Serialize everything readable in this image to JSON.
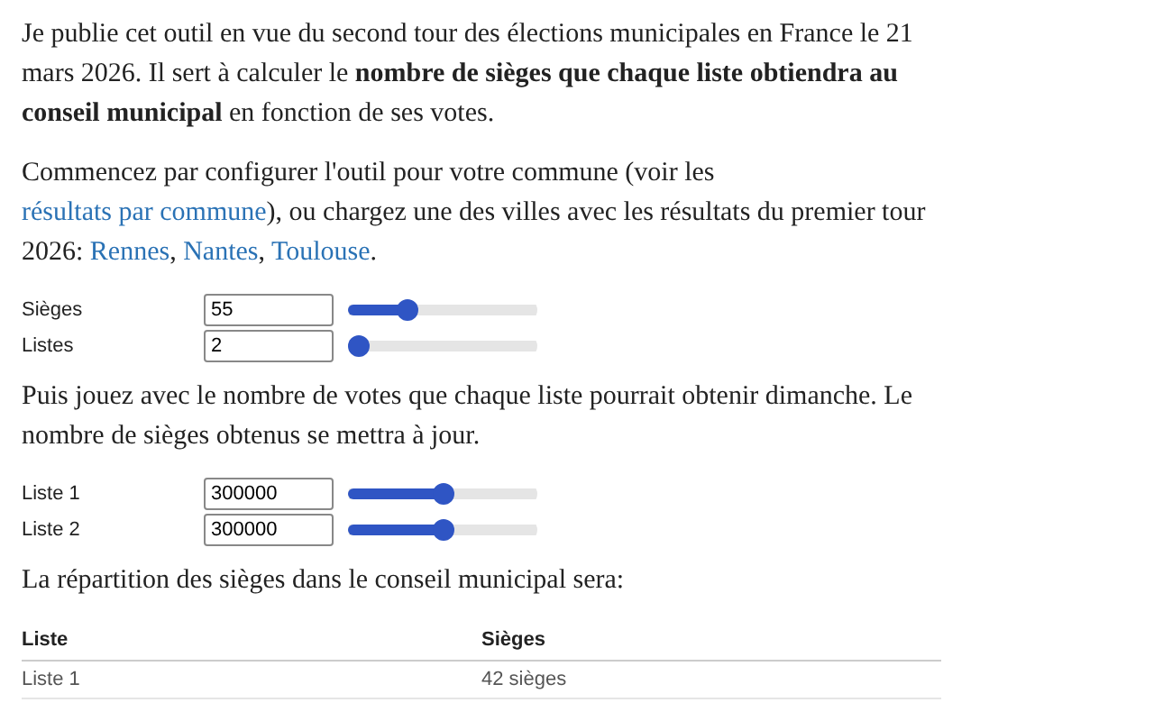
{
  "intro": "Je publie cet outil en vue du second tour des élections municipales en France le 21 mars 2026. Il sert à calculer le **nombre de sièges que chaque liste obtiendra au conseil municipal** en fonction de ses votes.",
  "setup_paragraph": [
    {
      "kind": "text",
      "text": "Commencez par configurer l'outil pour votre commune (voir les "
    },
    {
      "kind": "link",
      "text": "résultats par commune"
    },
    {
      "kind": "text",
      "text": "), ou chargez une des villes avec les résultats du premier tour 2026: "
    },
    {
      "kind": "link",
      "text": "Rennes"
    },
    {
      "kind": "text",
      "text": ", "
    },
    {
      "kind": "link",
      "text": "Nantes"
    },
    {
      "kind": "text",
      "text": ", "
    },
    {
      "kind": "link",
      "text": "Toulouse"
    },
    {
      "kind": "text",
      "text": "."
    }
  ],
  "settings": [
    {
      "label": "Sièges",
      "value": "55",
      "level": 0.29
    },
    {
      "label": "Listes",
      "value": "2",
      "level": 0
    }
  ],
  "votes_paragraph": "Puis jouez avec le nombre de votes que chaque liste pourrait obtenir dimanche. Le nombre de sièges obtenus se mettra à jour.",
  "votes": [
    {
      "label": "Liste 1",
      "value": "300000",
      "level": 0.5
    },
    {
      "label": "Liste 2",
      "value": "300000",
      "level": 0.5
    }
  ],
  "result_paragraph": "La répartition des sièges dans le conseil municipal sera:",
  "table": {
    "columns": [
      "Liste",
      "Sièges"
    ],
    "rows": [
      [
        "Liste 1",
        "42 sièges"
      ]
    ]
  }
}
